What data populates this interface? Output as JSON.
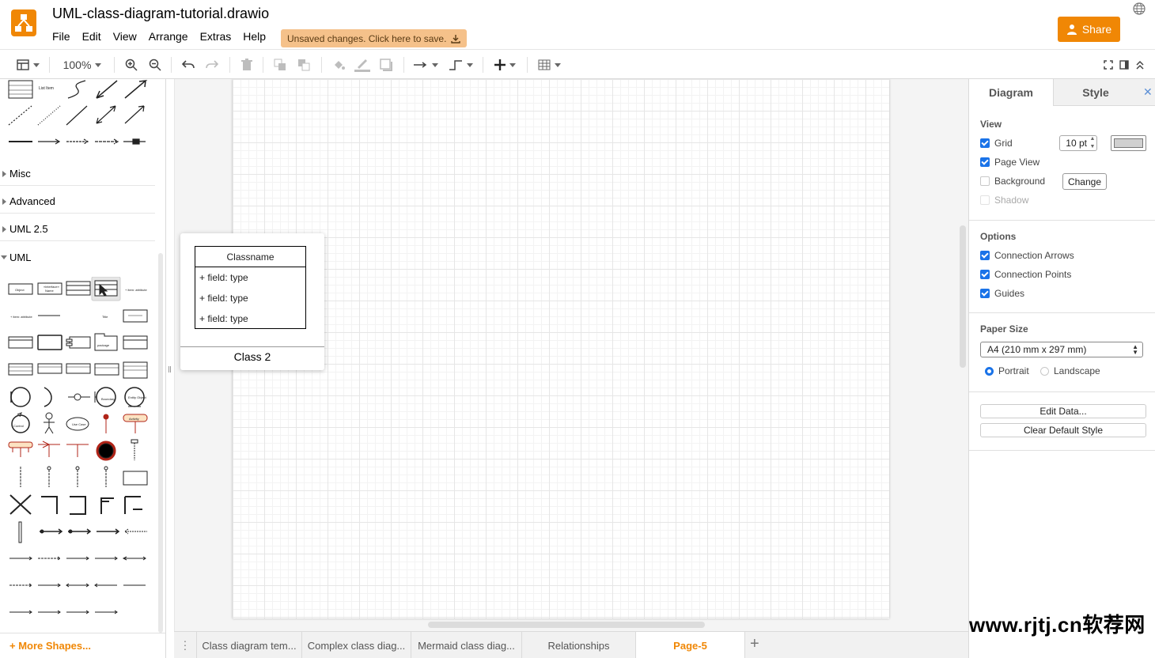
{
  "app": {
    "title": "UML-class-diagram-tutorial.drawio",
    "logo_icon": "drawio-logo-icon",
    "accent_color": "#f08705"
  },
  "menu": [
    "File",
    "Edit",
    "View",
    "Arrange",
    "Extras",
    "Help"
  ],
  "unsaved_banner": "Unsaved changes. Click here to save.",
  "share_label": "Share",
  "toolbar": {
    "zoom": "100%",
    "icons": [
      "format-panel-icon",
      "zoom-in-icon",
      "zoom-out-icon",
      "undo-icon",
      "redo-icon",
      "delete-icon",
      "to-front-icon",
      "to-back-icon",
      "fill-color-icon",
      "line-color-icon",
      "shadow-icon",
      "connection-icon",
      "waypoints-icon",
      "insert-icon",
      "table-icon",
      "fullscreen-icon",
      "format-toggle-icon",
      "collapse-icon"
    ]
  },
  "sidebar": {
    "sections": [
      {
        "label": "Misc",
        "open": false
      },
      {
        "label": "Advanced",
        "open": false
      },
      {
        "label": "UML 2.5",
        "open": false
      },
      {
        "label": "UML",
        "open": true
      }
    ],
    "more_shapes": "+ More Shapes..."
  },
  "preview": {
    "class_name": "Classname",
    "fields": [
      "+ field: type",
      "+ field: type",
      "+ field: type"
    ],
    "label": "Class 2"
  },
  "format_panel": {
    "tabs": [
      "Diagram",
      "Style"
    ],
    "view": {
      "title": "View",
      "grid_label": "Grid",
      "grid_size": "10 pt",
      "page_view_label": "Page View",
      "background_label": "Background",
      "change_label": "Change",
      "shadow_label": "Shadow"
    },
    "options": {
      "title": "Options",
      "items": [
        "Connection Arrows",
        "Connection Points",
        "Guides"
      ]
    },
    "paper": {
      "title": "Paper Size",
      "size": "A4 (210 mm x 297 mm)",
      "portrait": "Portrait",
      "landscape": "Landscape"
    },
    "edit_data": "Edit Data...",
    "clear_style": "Clear Default Style"
  },
  "pages": [
    "Class diagram tem...",
    "Complex class diag...",
    "Mermaid class diag...",
    "Relationships",
    "Page-5"
  ],
  "active_page": "Page-5",
  "watermark": "www.rjtj.cn软荐网"
}
